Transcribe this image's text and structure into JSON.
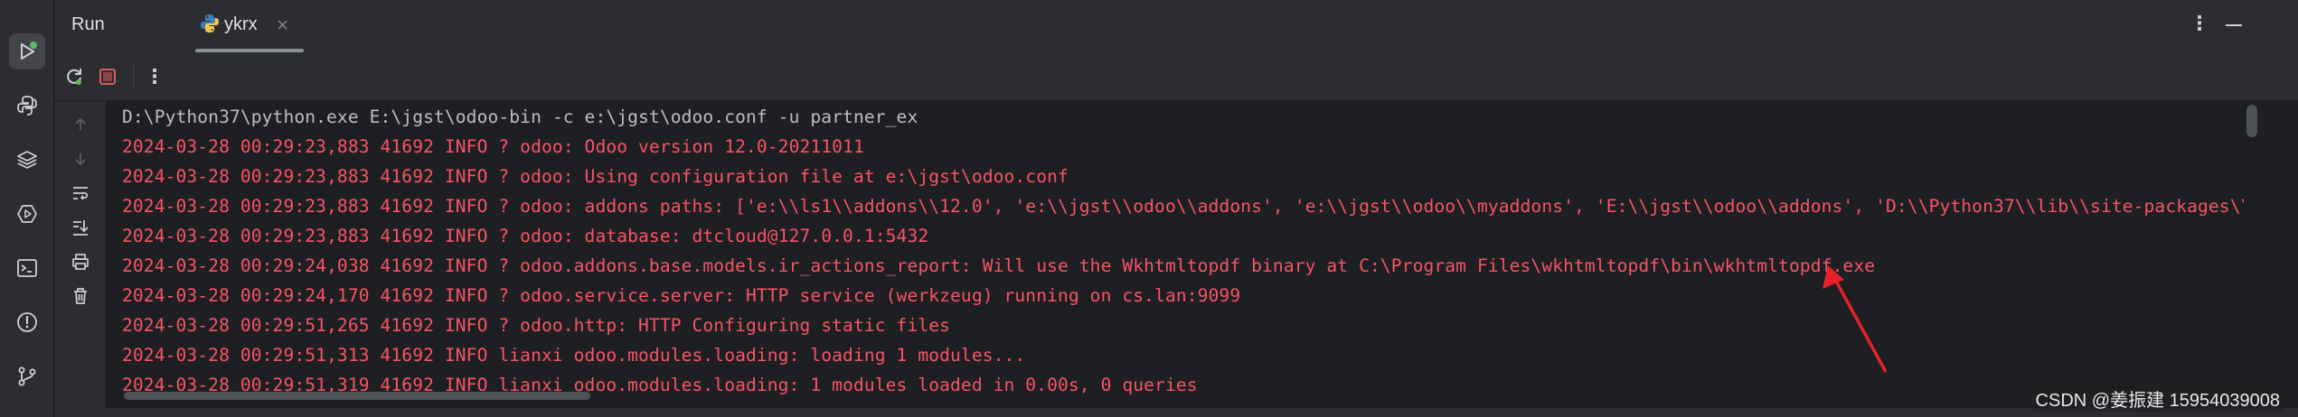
{
  "header": {
    "title": "Run",
    "tab_label": "ykrx",
    "close_glyph": "×",
    "more_glyph": "⋮"
  },
  "toolbar": {
    "more_glyph": "⋮"
  },
  "console": {
    "lines": [
      {
        "text": "D:\\Python37\\python.exe E:\\jgst\\odoo-bin -c e:\\jgst\\odoo.conf -u partner_ex",
        "kind": "cmd"
      },
      {
        "text": "2024-03-28 00:29:23,883 41692 INFO ? odoo: Odoo version 12.0-20211011",
        "kind": "err"
      },
      {
        "text": "2024-03-28 00:29:23,883 41692 INFO ? odoo: Using configuration file at e:\\jgst\\odoo.conf",
        "kind": "err"
      },
      {
        "text": "2024-03-28 00:29:23,883 41692 INFO ? odoo: addons paths: ['e:\\\\ls1\\\\addons\\\\12.0', 'e:\\\\jgst\\\\odoo\\\\addons', 'e:\\\\jgst\\\\odoo\\\\myaddons', 'E:\\\\jgst\\\\odoo\\\\addons', 'D:\\\\Python37\\\\lib\\\\site-packages\\\\",
        "kind": "err"
      },
      {
        "text": "2024-03-28 00:29:23,883 41692 INFO ? odoo: database: dtcloud@127.0.0.1:5432",
        "kind": "err"
      },
      {
        "text": "2024-03-28 00:29:24,038 41692 INFO ? odoo.addons.base.models.ir_actions_report: Will use the Wkhtmltopdf binary at C:\\Program Files\\wkhtmltopdf\\bin\\wkhtmltopdf.exe",
        "kind": "err"
      },
      {
        "text": "2024-03-28 00:29:24,170 41692 INFO ? odoo.service.server: HTTP service (werkzeug) running on cs.lan:9099",
        "kind": "err"
      },
      {
        "text": "2024-03-28 00:29:51,265 41692 INFO ? odoo.http: HTTP Configuring static files",
        "kind": "err"
      },
      {
        "text": "2024-03-28 00:29:51,313 41692 INFO lianxi odoo.modules.loading: loading 1 modules...",
        "kind": "err"
      },
      {
        "text": "2024-03-28 00:29:51,319 41692 INFO lianxi odoo.modules.loading: 1 modules loaded in 0.00s, 0 queries",
        "kind": "err"
      }
    ]
  },
  "watermark": "CSDN @姜振建 15954039008",
  "colors": {
    "error_text": "#f75464",
    "command_text": "#bcbec4",
    "annotation_arrow": "#e8202a",
    "run_indicator": "#5fb865"
  },
  "icons": {
    "activity_bar": [
      "run-icon",
      "python-console-icon",
      "layers-icon",
      "services-icon",
      "terminal-icon",
      "problems-icon",
      "git-icon"
    ],
    "toolbar": [
      "rerun-icon",
      "stop-icon",
      "more-icon"
    ],
    "gutter": [
      "arrow-up-icon",
      "arrow-down-icon",
      "soft-wrap-icon",
      "scroll-to-end-icon",
      "print-icon",
      "trash-icon"
    ]
  }
}
